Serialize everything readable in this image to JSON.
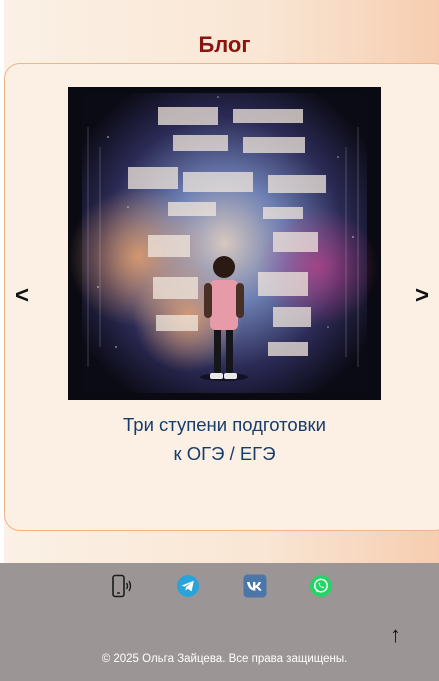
{
  "page": {
    "title": "Блог"
  },
  "carousel": {
    "prev_label": "<",
    "next_label": ">",
    "post": {
      "title_line1": "Три ступени подготовки",
      "title_line2": "к ОГЭ / ЕГЭ"
    }
  },
  "footer": {
    "social_icons": [
      "phone-icon",
      "telegram-icon",
      "vk-icon",
      "whatsapp-icon"
    ],
    "back_to_top_label": "↑",
    "copyright": "© 2025 Ольга Зайцева. Все права защищены."
  },
  "colors": {
    "title": "#8a1510",
    "post_title": "#163c6c",
    "card_border": "#eeb48a",
    "card_bg": "#fbf0e3",
    "footer_bg": "#9b9695",
    "telegram": "#2aa3db",
    "vk": "#4a76a8",
    "whatsapp": "#25d366"
  }
}
